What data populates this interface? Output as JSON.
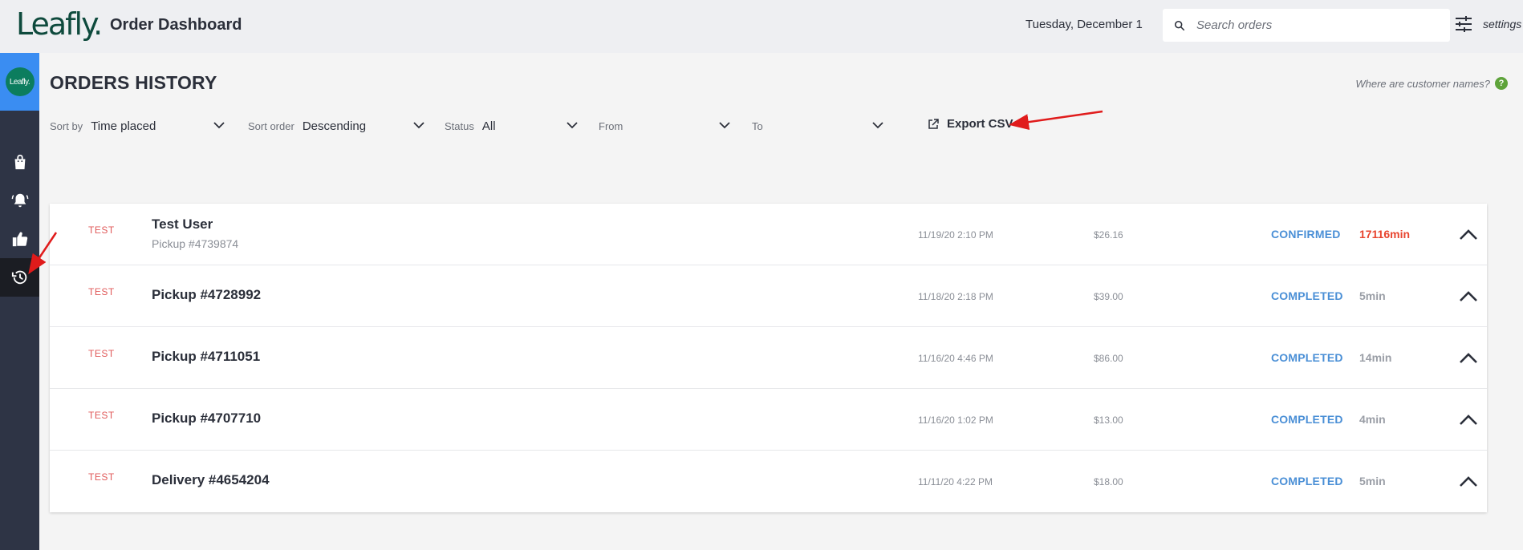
{
  "header": {
    "logo": "Leafly.",
    "title": "Order Dashboard",
    "date": "Tuesday, December 1",
    "search_placeholder": "Search orders",
    "settings_label": "settings"
  },
  "sidebar": {
    "brand_badge": "Leafly.",
    "items": [
      {
        "name": "orders",
        "icon": "shopping-bag-icon"
      },
      {
        "name": "notifications",
        "icon": "bell-icon"
      },
      {
        "name": "feedback",
        "icon": "thumbs-up-icon"
      },
      {
        "name": "history",
        "icon": "history-icon",
        "active": true
      }
    ]
  },
  "main": {
    "page_title": "ORDERS HISTORY",
    "help_text": "Where are customer names?",
    "help_icon": "?",
    "filters": {
      "sort_by": {
        "label": "Sort by",
        "value": "Time placed"
      },
      "sort_order": {
        "label": "Sort order",
        "value": "Descending"
      },
      "status": {
        "label": "Status",
        "value": "All"
      },
      "from": {
        "label": "From",
        "value": ""
      },
      "to": {
        "label": "To",
        "value": ""
      }
    },
    "export_label": "Export CSV"
  },
  "orders": [
    {
      "tag": "TEST",
      "name": "Test User",
      "sub": "Pickup #4739874",
      "time": "11/19/20 2:10 PM",
      "price": "$26.16",
      "status": "CONFIRMED",
      "elapsed": "17116min",
      "late": true
    },
    {
      "tag": "TEST",
      "name": "Pickup #4728992",
      "sub": "",
      "time": "11/18/20 2:18 PM",
      "price": "$39.00",
      "status": "COMPLETED",
      "elapsed": "5min",
      "late": false
    },
    {
      "tag": "TEST",
      "name": "Pickup #4711051",
      "sub": "",
      "time": "11/16/20 4:46 PM",
      "price": "$86.00",
      "status": "COMPLETED",
      "elapsed": "14min",
      "late": false
    },
    {
      "tag": "TEST",
      "name": "Pickup #4707710",
      "sub": "",
      "time": "11/16/20 1:02 PM",
      "price": "$13.00",
      "status": "COMPLETED",
      "elapsed": "4min",
      "late": false
    },
    {
      "tag": "TEST",
      "name": "Delivery #4654204",
      "sub": "",
      "time": "11/11/20 4:22 PM",
      "price": "$18.00",
      "status": "COMPLETED",
      "elapsed": "5min",
      "late": false
    }
  ],
  "colors": {
    "brand_green": "#0e4a3d",
    "sidebar_bg": "#2e3445",
    "accent_blue": "#3a8df2",
    "status_blue": "#4a8fd6",
    "late_red": "#e8452f",
    "annotation_red": "#e01b1b"
  }
}
